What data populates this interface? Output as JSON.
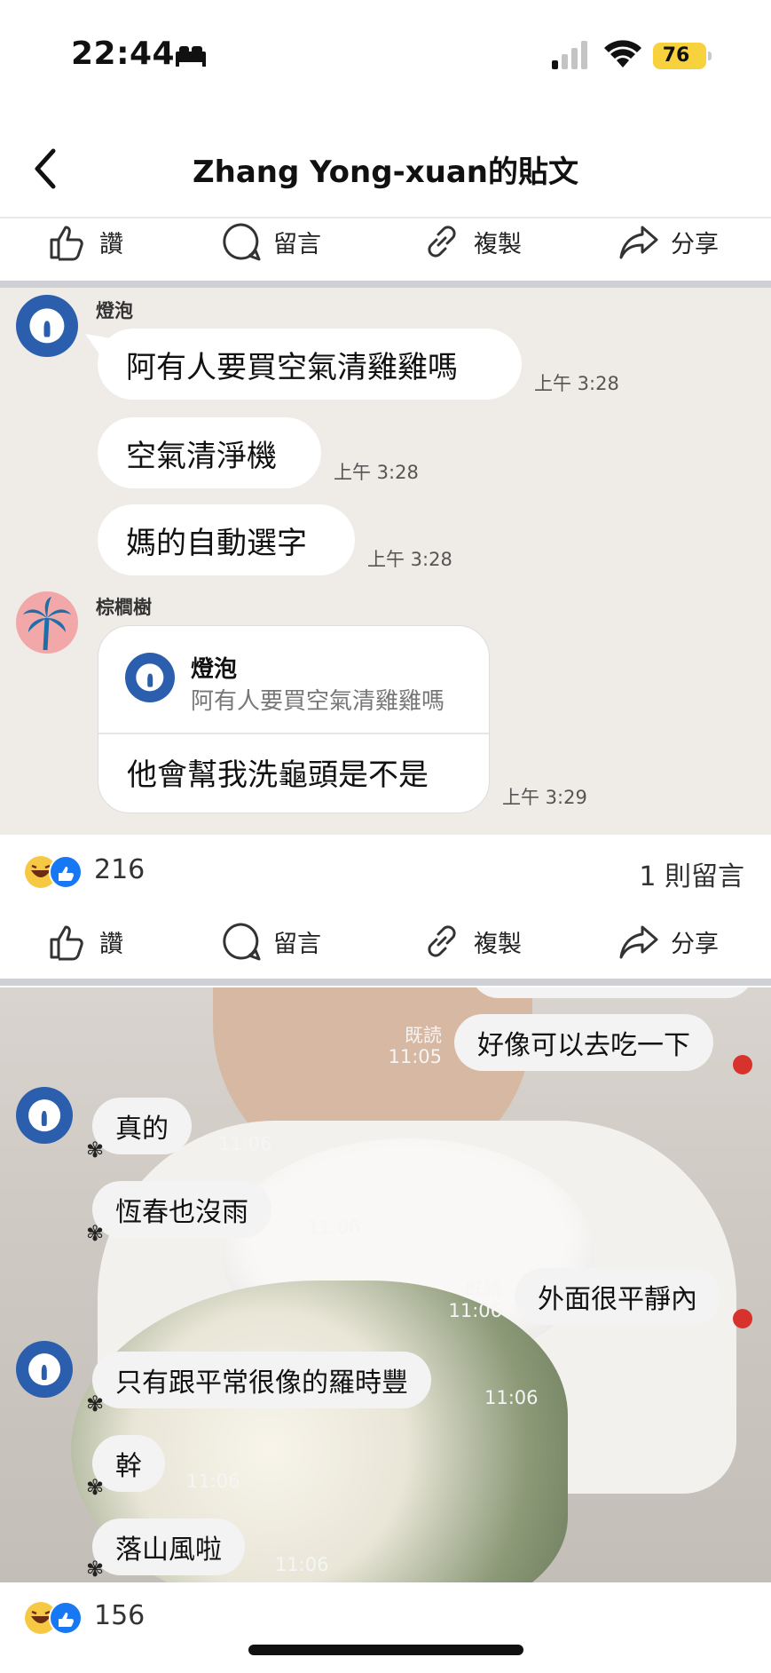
{
  "status_bar": {
    "time": "22:44",
    "battery": "76"
  },
  "header": {
    "title": "Zhang Yong-xuan的貼文"
  },
  "action_bar": {
    "like": "讚",
    "comment": "留言",
    "copy": "複製",
    "share": "分享"
  },
  "post1": {
    "messages": [
      {
        "sender": "燈泡",
        "text": "阿有人要買空氣清雞雞嗎",
        "time": "上午 3:28"
      },
      {
        "text": "空氣清淨機",
        "time": "上午 3:28"
      },
      {
        "text": "媽的自動選字",
        "time": "上午 3:28"
      }
    ],
    "reply": {
      "sender": "棕櫚樹",
      "quoted_name": "燈泡",
      "quoted_text": "阿有人要買空氣清雞雞嗎",
      "text": "他會幫我洗龜頭是不是",
      "time": "上午 3:29"
    },
    "reaction_count": "216",
    "comment_count": "1 則留言"
  },
  "post2": {
    "messages": [
      {
        "side": "right",
        "text": "好像可以去吃一下",
        "read": "既読",
        "time": "11:05"
      },
      {
        "side": "left",
        "text": "真的",
        "time": "11:06"
      },
      {
        "side": "left",
        "text": "恆春也沒雨",
        "time": "11:06"
      },
      {
        "side": "right",
        "text": "外面很平靜內",
        "read": "既読",
        "time": "11:06"
      },
      {
        "side": "left",
        "text": "只有跟平常很像的羅時豐",
        "time": "11:06"
      },
      {
        "side": "left",
        "text": "幹",
        "time": "11:06"
      },
      {
        "side": "left",
        "text": "落山風啦",
        "time": "11:06"
      }
    ],
    "reaction_count": "156"
  },
  "colors": {
    "bulb_avatar": "#2b5fae",
    "line_chat_bg": "#efebe7",
    "battery": "#f7d23c",
    "like_blue": "#1877f2",
    "haha_yellow": "#f7c843"
  }
}
